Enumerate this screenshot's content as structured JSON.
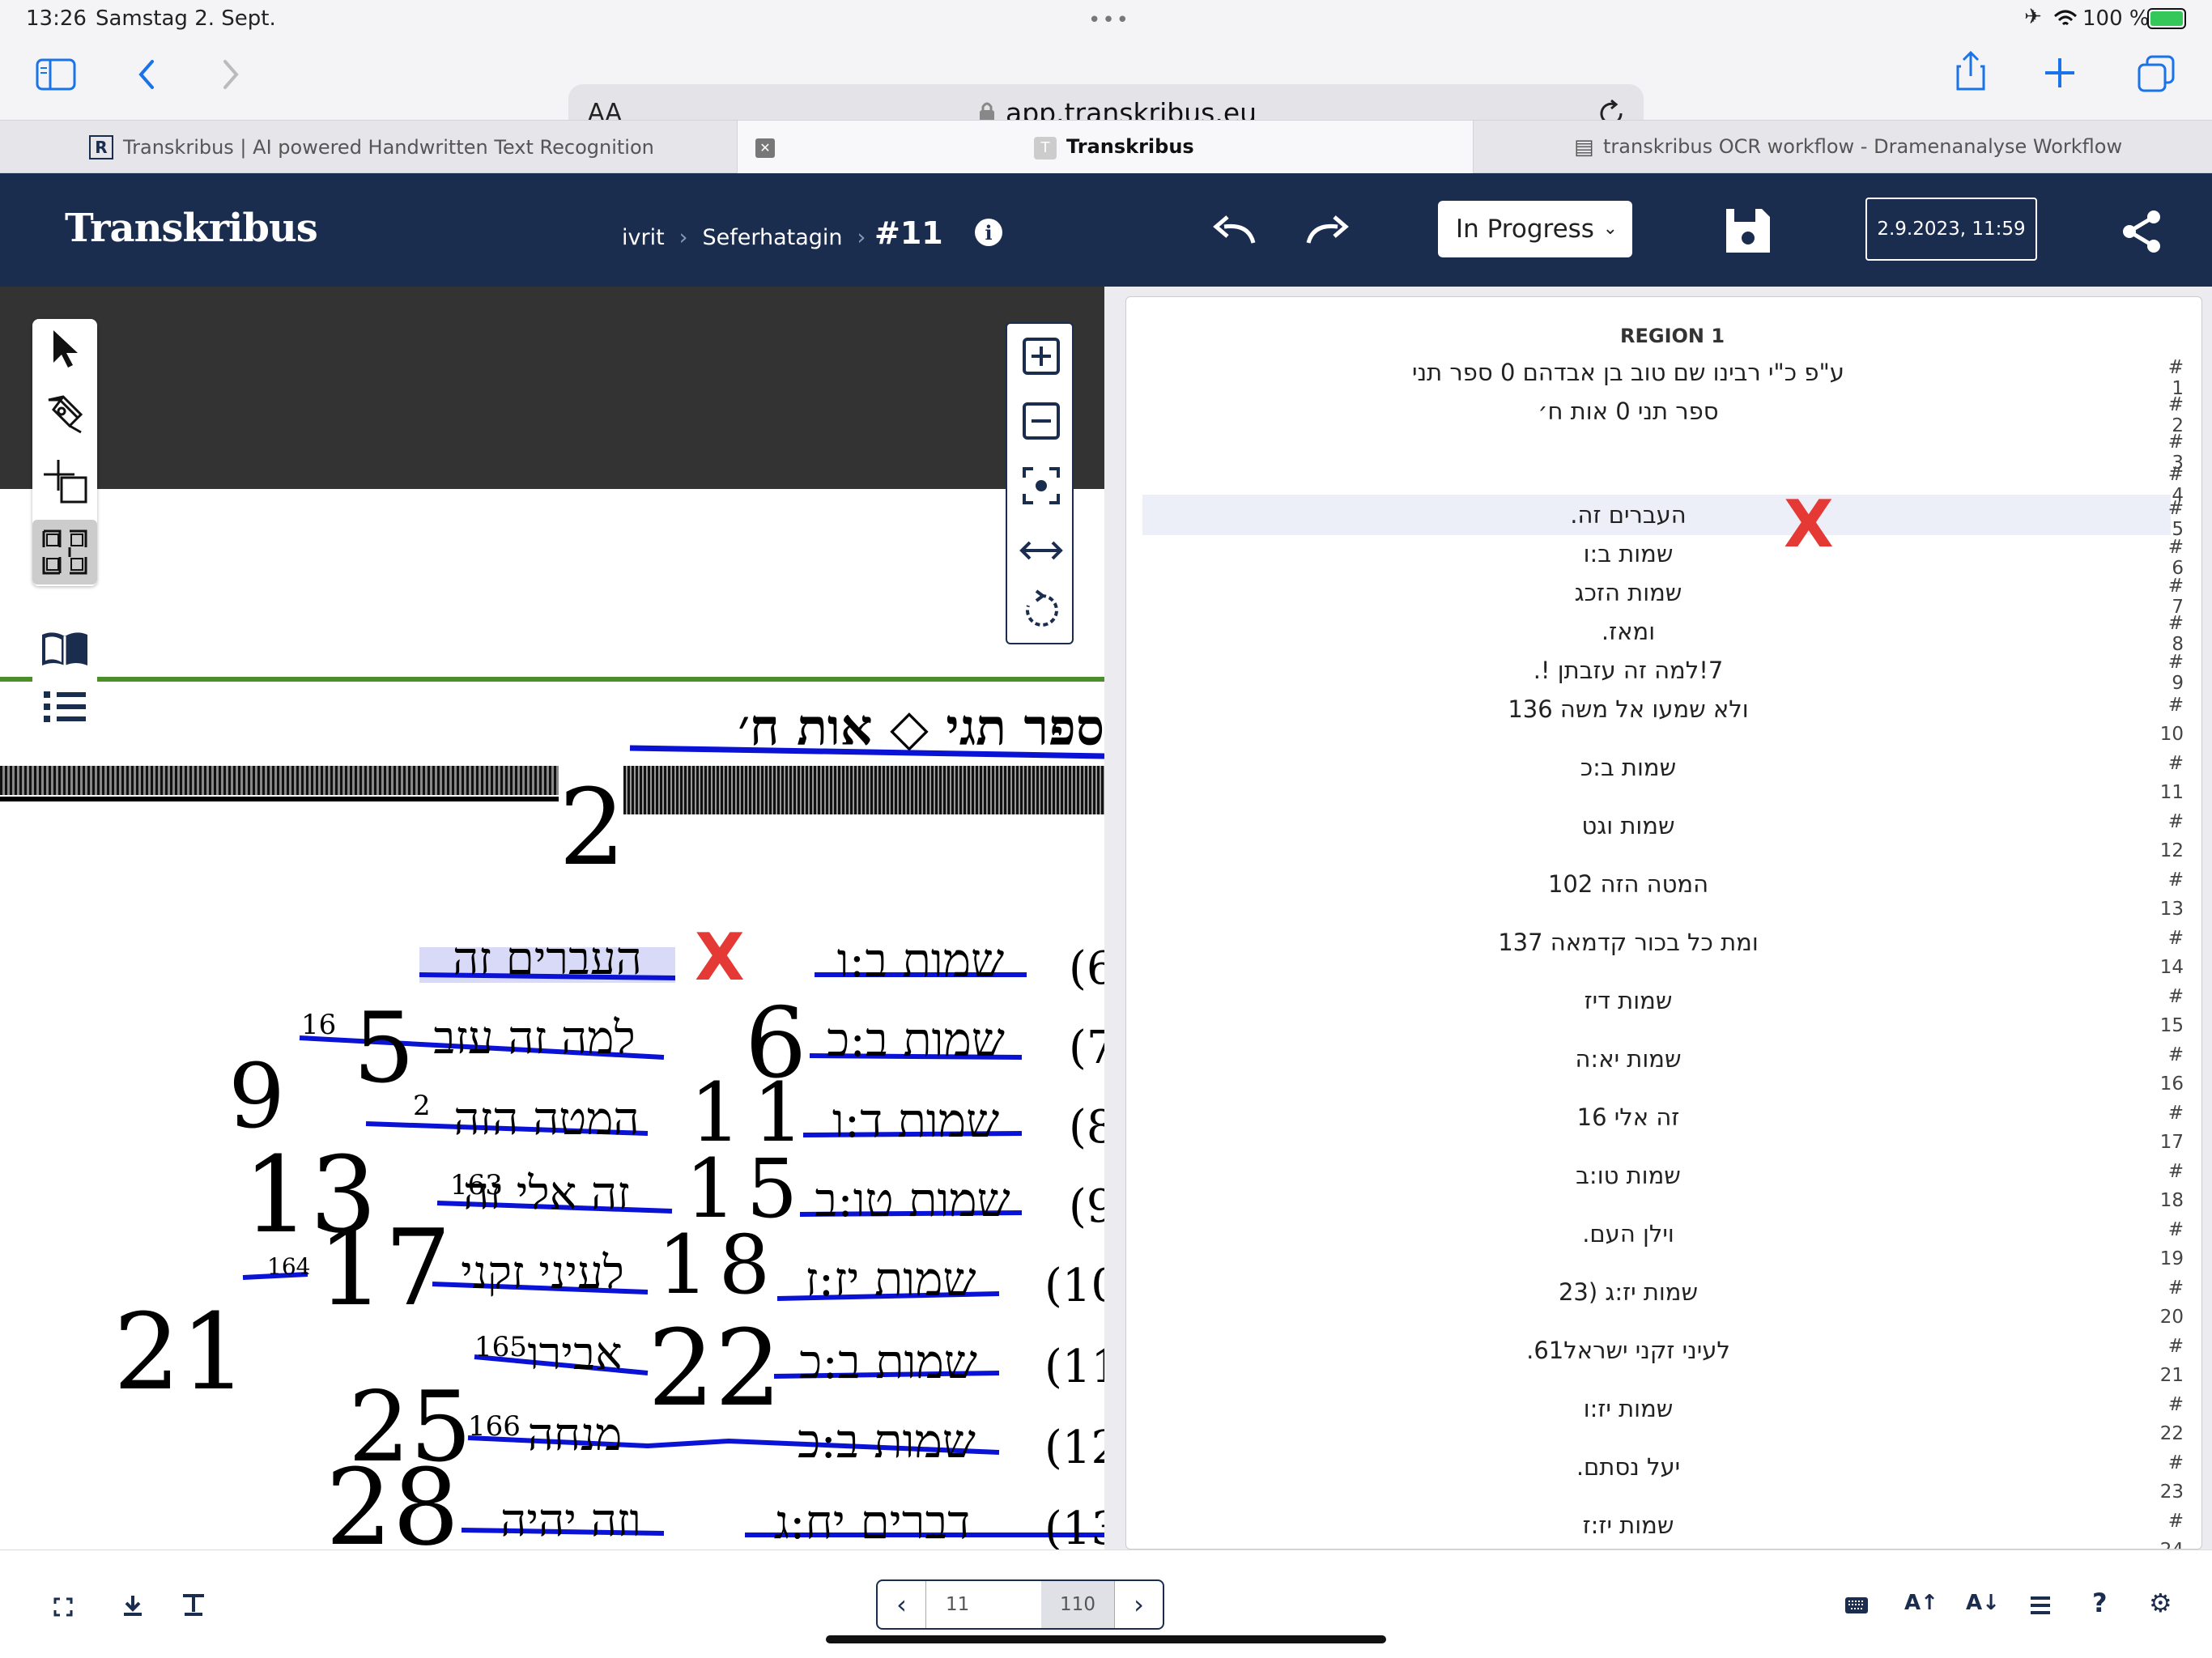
{
  "status_bar": {
    "time": "13:26",
    "date": "Samstag 2. Sept.",
    "battery": "100 %"
  },
  "browser": {
    "text_size_label": "AA",
    "url": "app.transkribus.eu",
    "tabs": [
      {
        "title": "Transkribus | AI powered Handwritten Text Recognition"
      },
      {
        "title": "Transkribus"
      },
      {
        "title": "transkribus OCR workflow - Dramenanalyse Workflow"
      }
    ]
  },
  "app": {
    "logo": "Transkribus",
    "breadcrumb": [
      "ivrit",
      "Seferhatagin"
    ],
    "page_ref": "#11",
    "status_select": "In Progress",
    "save_date": "2.9.2023, 11:59"
  },
  "transcription": {
    "region_label": "REGION 1",
    "lines": [
      {
        "n": "# 1",
        "text": "ע\"פ כ\"י רבינו שם טוב בן אבדהם 0 ספר תני"
      },
      {
        "n": "# 2",
        "text": "ספר תני 0 אות ח׳"
      },
      {
        "n": "# 3",
        "text": ""
      },
      {
        "n": "# 4",
        "text": ""
      },
      {
        "n": "# 5",
        "text": "העברים זה."
      },
      {
        "n": "# 6",
        "text": "שמות ב:ו"
      },
      {
        "n": "# 7",
        "text": "שמות הזכג"
      },
      {
        "n": "# 8",
        "text": "ומאז."
      },
      {
        "n": "# 9",
        "text": "7!למה זה עזבתן !."
      },
      {
        "n": "# 10",
        "text": "ולא שמעו אל משה 136"
      },
      {
        "n": "# 11",
        "text": "שמות ב:כ"
      },
      {
        "n": "# 12",
        "text": "שמות וגט"
      },
      {
        "n": "# 13",
        "text": "המטה הזה 102"
      },
      {
        "n": "# 14",
        "text": "ומת כל בכור קדמאה 137"
      },
      {
        "n": "# 15",
        "text": "שמות דיז"
      },
      {
        "n": "# 16",
        "text": "שמות יא:ה"
      },
      {
        "n": "# 17",
        "text": "זה אלי 16"
      },
      {
        "n": "# 18",
        "text": "שמות טו:ב"
      },
      {
        "n": "# 19",
        "text": "וילן העם."
      },
      {
        "n": "# 20",
        "text": "שמות יז:ג (23"
      },
      {
        "n": "# 21",
        "text": "לעיני זקני ישראל61."
      },
      {
        "n": "# 22",
        "text": "שמות יז:ו"
      },
      {
        "n": "# 23",
        "text": "יעל נסתם."
      },
      {
        "n": "# 24",
        "text": "שמות יז:ז"
      }
    ]
  },
  "scan": {
    "header": "ספר תגי ◇ אות ח׳",
    "numbers": [
      "2",
      "5",
      "6",
      "9",
      "11",
      "13",
      "15",
      "17",
      "18",
      "21",
      "22",
      "25",
      "28"
    ],
    "row_labels": [
      "(6",
      "(7",
      "(8",
      "(9",
      "(10",
      "(11",
      "(12",
      "(13"
    ],
    "right_words": [
      "שמות ב:ו",
      "שמות ב:כ",
      "שמות ד:ו",
      "שמות טו:ב",
      "שמות יז:ז",
      "שמות ב:כ",
      "שמות ב:כ",
      "דברים יח:ג"
    ],
    "left_words": [
      "העברים זה",
      "למה זה עזב",
      "המטה הזה",
      "זה אלי זה",
      "לעיני זקני",
      "אבירו",
      "מנחה",
      "וזה יהיה"
    ],
    "small_nums": [
      "16",
      "2",
      "163",
      "164",
      "165",
      "166"
    ],
    "markers": [
      "X"
    ]
  },
  "pagination": {
    "current": "11",
    "total": "110"
  },
  "colors": {
    "header_bg": "#1b2d4f",
    "baseline": "#0a12d6",
    "highlight": "#eceff8",
    "mark": "#e53935",
    "green_line": "#4a8f2a"
  }
}
